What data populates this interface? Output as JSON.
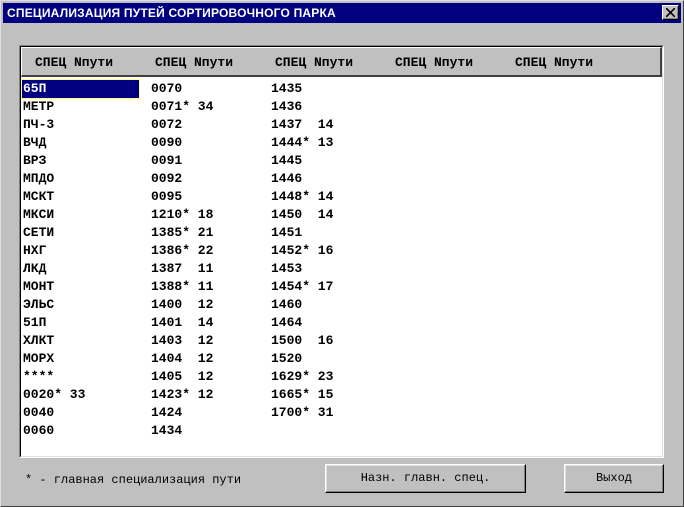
{
  "window": {
    "title": "СПЕЦИАЛИЗАЦИЯ ПУТЕЙ СОРТИРОВОЧНОГО ПАРКА"
  },
  "table": {
    "headers": [
      "СПЕЦ Nпути",
      "СПЕЦ Nпути",
      "СПЕЦ Nпути",
      "СПЕЦ Nпути",
      "СПЕЦ Nпути"
    ],
    "columns": [
      [
        "65П",
        "МЕТР",
        "ПЧ-3",
        "ВЧД",
        "ВРЗ",
        "МПДО",
        "МСКТ",
        "МКСИ",
        "СЕТИ",
        "НХГ",
        "ЛКД",
        "МОНТ",
        "ЭЛЬС",
        "51П",
        "ХЛКТ",
        "МОРХ",
        "****",
        "0020* 33",
        "0040",
        "0060"
      ],
      [
        "0070",
        "0071* 34",
        "0072",
        "0090",
        "0091",
        "0092",
        "0095",
        "1210* 18",
        "1385* 21",
        "1386* 22",
        "1387  11",
        "1388* 11",
        "1400  12",
        "1401  14",
        "1403  12",
        "1404  12",
        "1405  12",
        "1423* 12",
        "1424",
        "1434"
      ],
      [
        "1435",
        "1436",
        "1437  14",
        "1444* 13",
        "1445",
        "1446",
        "1448* 14",
        "1450  14",
        "1451",
        "1452* 16",
        "1453",
        "1454* 17",
        "1460",
        "1464",
        "1500  16",
        "1520",
        "1629* 23",
        "1665* 15",
        "1700* 31"
      ],
      [],
      []
    ],
    "selected": "65П"
  },
  "footer": {
    "note": "* - главная специализация пути",
    "assign_label": "Назн. главн. спец.",
    "exit_label": "Выход"
  },
  "icons": {
    "close": "close-icon"
  }
}
